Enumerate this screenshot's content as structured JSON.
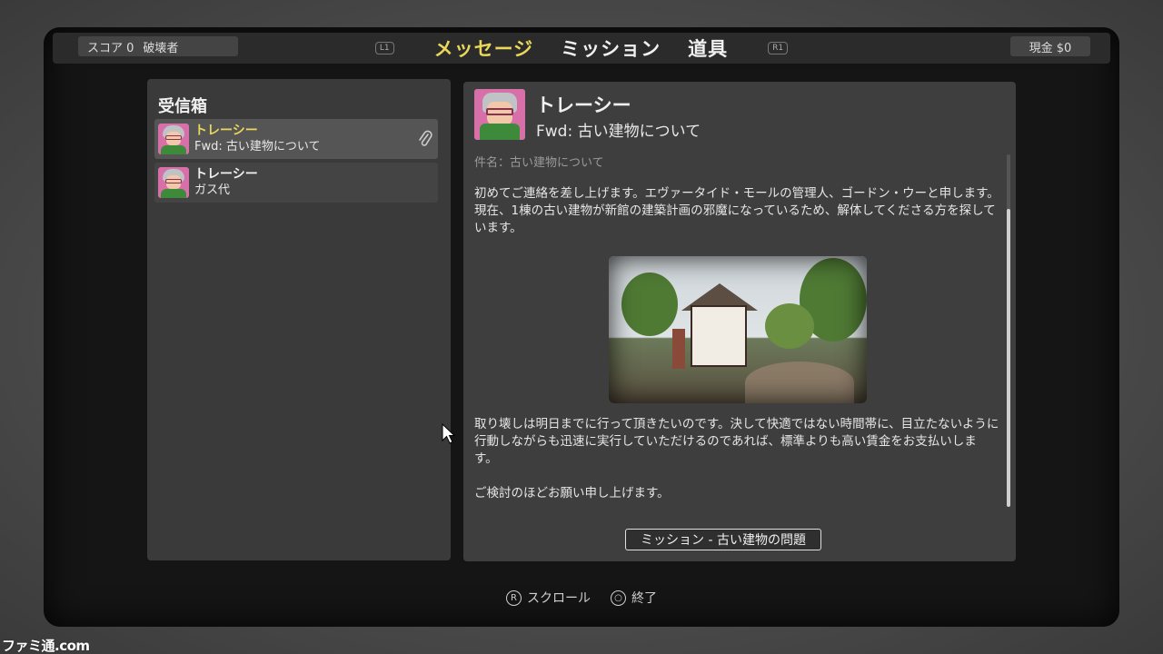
{
  "topbar": {
    "score_label": "スコア 0",
    "rank_label": "破壊者",
    "left_shoulder": "L1",
    "right_shoulder": "R1",
    "cash_label": "現金 $0",
    "tabs": [
      {
        "label": "メッセージ",
        "active": true
      },
      {
        "label": "ミッション",
        "active": false
      },
      {
        "label": "道具",
        "active": false
      }
    ]
  },
  "inbox": {
    "title": "受信箱",
    "messages": [
      {
        "sender": "トレーシー",
        "subject": "Fwd: 古い建物について",
        "selected": true,
        "attachment_icon": "paperclip-icon"
      },
      {
        "sender": "トレーシー",
        "subject": "ガス代",
        "selected": false
      }
    ]
  },
  "message": {
    "sender": "トレーシー",
    "subject": "Fwd: 古い建物について",
    "subject_line": "件名：古い建物について",
    "para1": "初めてご連絡を差し上げます。エヴァータイド・モールの管理人、ゴードン・ウーと申します。現在、1棟の古い建物が新館の建築計画の邪魔になっているため、解体してくださる方を探しています。",
    "para2": "取り壊しは明日までに行って頂きたいのです。決して快適ではない時間帯に、目立たないように行動しながらも迅速に実行していただけるのであれば、標準よりも高い賃金をお支払いします。",
    "para3": "ご検討のほどお願い申し上げます。",
    "mission_button": "ミッション - 古い建物の問題"
  },
  "footer": {
    "scroll_glyph": "R",
    "scroll_label": "スクロール",
    "exit_glyph": "○",
    "exit_label": "終了"
  },
  "watermark": "ファミ通.com",
  "colors": {
    "accent": "#e9d85a",
    "panel": "#3a3a3a"
  }
}
